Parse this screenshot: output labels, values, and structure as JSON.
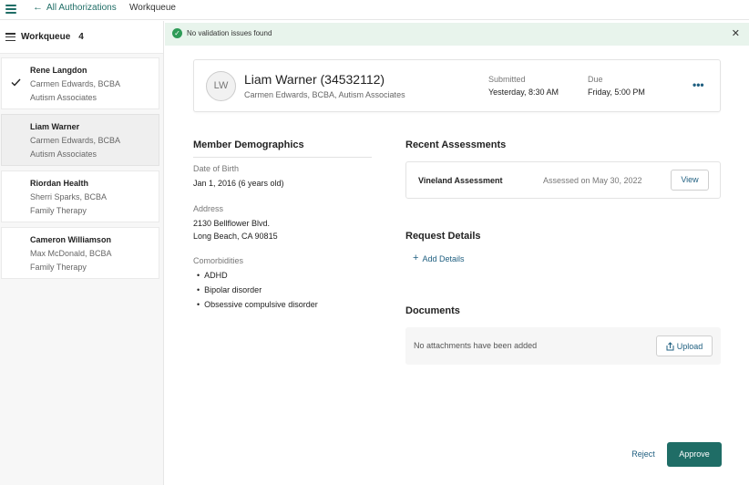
{
  "topbar": {
    "back_label": "All Authorizations",
    "current": "Workqueue"
  },
  "sidebar": {
    "title": "Workqueue",
    "count": "4",
    "items": [
      {
        "name": "Rene Langdon",
        "line1": "Carmen Edwards, BCBA",
        "line2": "Autism Associates",
        "checked": true
      },
      {
        "name": "Liam Warner",
        "line1": "Carmen Edwards, BCBA",
        "line2": "Autism Associates",
        "selected": true
      },
      {
        "name": "Riordan Health",
        "line1": "Sherri Sparks, BCBA",
        "line2": "Family Therapy"
      },
      {
        "name": "Cameron Williamson",
        "line1": "Max McDonald, BCBA",
        "line2": "Family Therapy"
      }
    ]
  },
  "banner": {
    "message": "No validation issues found",
    "close": "✕"
  },
  "member": {
    "initials": "LW",
    "name": "Liam Warner (34532112)",
    "subtitle": "Carmen Edwards, BCBA, Autism Associates",
    "submitted_label": "Submitted",
    "submitted_value": "Yesterday, 8:30 AM",
    "due_label": "Due",
    "due_value": "Friday, 5:00 PM",
    "more": "•••"
  },
  "demographics": {
    "title": "Member Demographics",
    "dob_label": "Date of Birth",
    "dob_value": "Jan 1, 2016 (6 years old)",
    "address_label": "Address",
    "address_line1": "2130 Bellflower Blvd.",
    "address_line2": "Long Beach, CA 90815",
    "comorbidities_label": "Comorbidities",
    "comorbidities": [
      "ADHD",
      "Bipolar disorder",
      "Obsessive compulsive disorder"
    ]
  },
  "assessments": {
    "title": "Recent Assessments",
    "item_title": "Vineland Assessment",
    "item_date": "Assessed on May 30, 2022",
    "view_label": "View"
  },
  "request": {
    "title": "Request Details",
    "add_label": "Add Details"
  },
  "documents": {
    "title": "Documents",
    "empty_message": "No attachments have been added",
    "upload_label": "Upload"
  },
  "actions": {
    "reject_label": "Reject",
    "approve_label": "Approve"
  },
  "colors": {
    "accent": "#1f6d66",
    "link": "#1f5f80",
    "success_bg": "#e8f4ec",
    "success": "#2e9b57"
  }
}
